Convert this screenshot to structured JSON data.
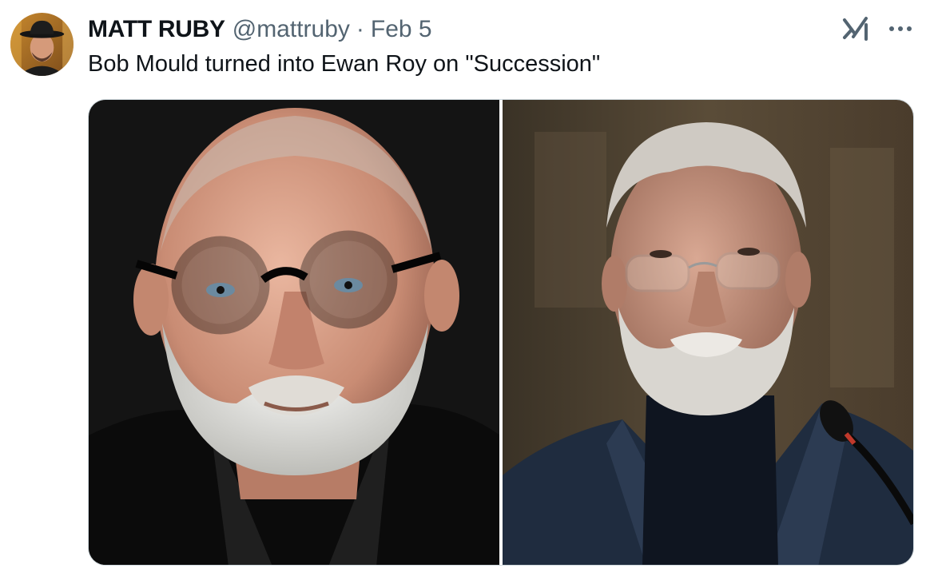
{
  "tweet": {
    "author": {
      "display_name": "MATT RUBY",
      "handle": "@mattruby",
      "separator": "·",
      "date": "Feb 5",
      "avatar_icon": "avatar-man-with-hat"
    },
    "text": "Bob Mould turned into Ewan Roy on \"Succession\"",
    "media": [
      {
        "subject": "bald-man-round-black-glasses-white-beard",
        "background": "#151515"
      },
      {
        "subject": "elderly-man-reading-glasses-white-beard-dark-suit",
        "background": "#4a3f30"
      }
    ],
    "actions": {
      "grok_icon": "grok-icon",
      "more_icon": "more-options-icon"
    }
  },
  "colors": {
    "text_primary": "#0f1419",
    "text_secondary": "#536471",
    "border": "#cfd9de"
  }
}
